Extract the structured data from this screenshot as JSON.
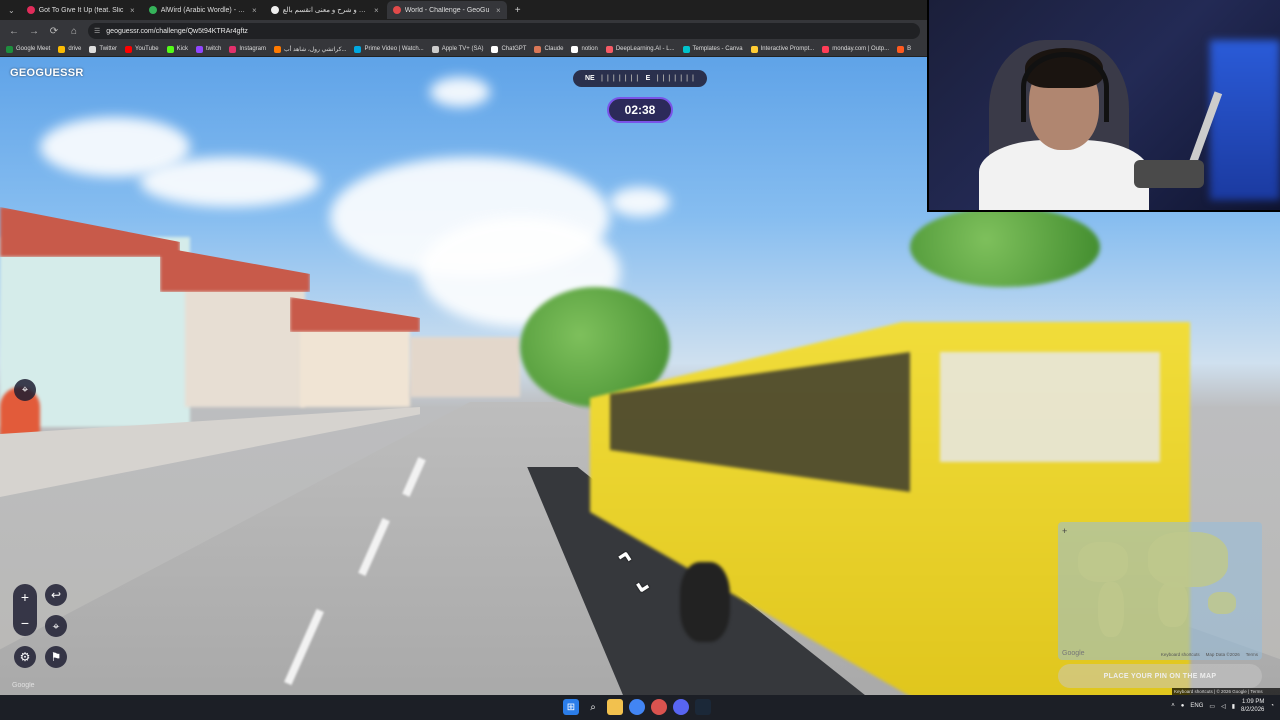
{
  "browser": {
    "tab_menu": "⌄",
    "tabs": [
      {
        "title": "Got To Give It Up (feat. Slic",
        "color": "#e02c5a"
      },
      {
        "title": "AlWird (Arabic Wordle) - الورد",
        "color": "#35b35a"
      },
      {
        "title": "تعريف و شرح و معنى انقسم بالع",
        "color": "#eeeeee"
      },
      {
        "title": "World - Challenge - GeoGu",
        "color": "#e24a4a"
      }
    ],
    "new_tab": "+",
    "url": "geoguessr.com/challenge/Qw5t94KTRAr4gftz",
    "bookmarks": [
      {
        "label": "Google Meet",
        "color": "#1e8e3e"
      },
      {
        "label": "drive",
        "color": "#fbbc04"
      },
      {
        "label": "Twitter",
        "color": "#dddddd"
      },
      {
        "label": "YouTube",
        "color": "#ff0000"
      },
      {
        "label": "Kick",
        "color": "#53fc18"
      },
      {
        "label": "twitch",
        "color": "#9146ff"
      },
      {
        "label": "Instagram",
        "color": "#e1306c"
      },
      {
        "label": "كراتشي رول، شاهد أب...",
        "color": "#ff7a00"
      },
      {
        "label": "Prime Video | Watch...",
        "color": "#00a8e1"
      },
      {
        "label": "Apple TV+ (SA)",
        "color": "#cccccc"
      },
      {
        "label": "ChatGPT",
        "color": "#ffffff"
      },
      {
        "label": "Claude",
        "color": "#d97757"
      },
      {
        "label": "notion",
        "color": "#ffffff"
      },
      {
        "label": "DeepLearning.AI - L...",
        "color": "#f65b66"
      },
      {
        "label": "Templates - Canva",
        "color": "#00c4cc"
      },
      {
        "label": "Interactive Prompt...",
        "color": "#ffcc33"
      },
      {
        "label": "monday.com | Outp...",
        "color": "#ff3d57"
      },
      {
        "label": "B",
        "color": "#ff5a1f"
      }
    ]
  },
  "game": {
    "logo": "GEOGUESSR",
    "compass": {
      "left": "NE",
      "right": "E",
      "ticks": "| | | | | | |"
    },
    "timer": "02:38",
    "side_pin": "⌖",
    "zoom_in": "+",
    "zoom_out": "−",
    "undo": "↩",
    "checkpoint": "⌖",
    "settings": "⚙",
    "flag": "⚑",
    "google_watermark": "Google"
  },
  "minimap": {
    "zoom_plus": "+",
    "google": "Google",
    "shortcuts": "Keyboard shortcuts",
    "map_data": "Map Data ©2026",
    "terms": "Terms",
    "place_pin": "PLACE YOUR PIN ON THE MAP",
    "footer": "Keyboard shortcuts | © 2026 Google | Terms"
  },
  "taskbar": {
    "lang": "ENG",
    "time": "1:09 PM",
    "date": "8/2/2026",
    "tray_up": "˄"
  },
  "colors": {
    "accent": "#7a54e8",
    "timer_bg": "#2c2a5a",
    "bus_yellow": "#f1dd3a"
  }
}
